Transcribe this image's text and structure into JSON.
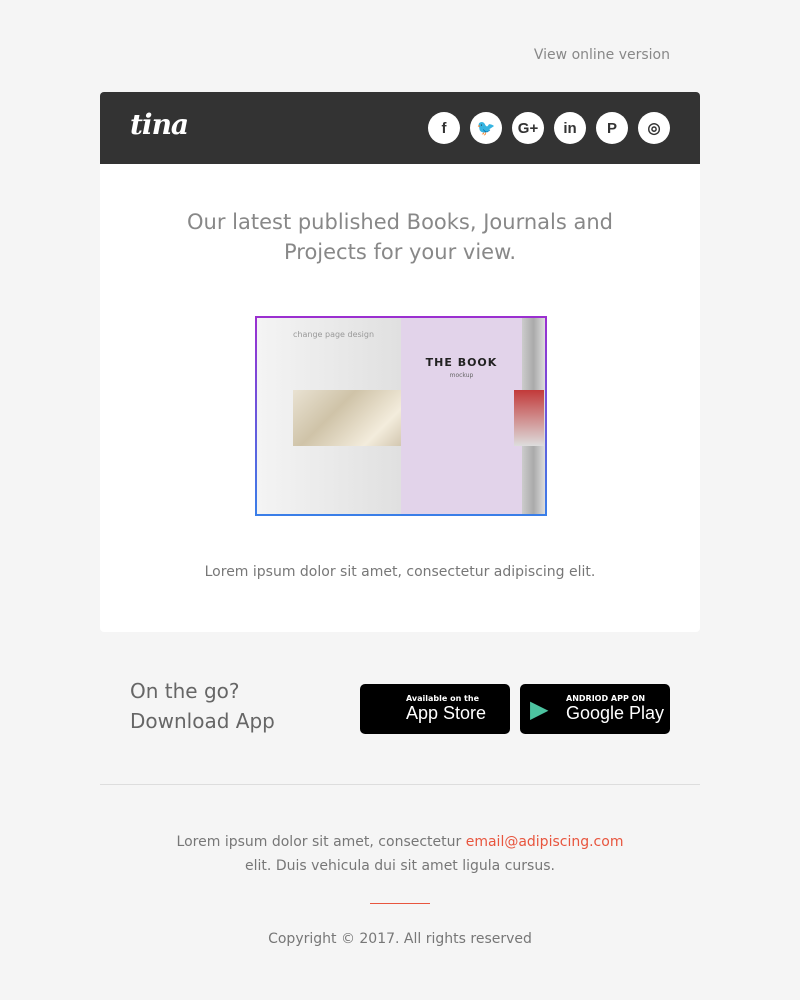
{
  "top": {
    "view_online": "View online version"
  },
  "header": {
    "logo": "tina",
    "socials": [
      {
        "name": "facebook",
        "glyph": "f"
      },
      {
        "name": "twitter",
        "glyph": "🐦"
      },
      {
        "name": "google-plus",
        "glyph": "G+"
      },
      {
        "name": "linkedin",
        "glyph": "in"
      },
      {
        "name": "pinterest",
        "glyph": "P"
      },
      {
        "name": "instagram",
        "glyph": "◎"
      }
    ]
  },
  "main": {
    "headline": "Our latest published Books, Journals and Projects for your view.",
    "book": {
      "left_title": "change page design",
      "right_title": "THE BOOK",
      "right_subtitle": "mockup"
    },
    "caption": "Lorem ipsum dolor sit amet, consectetur adipiscing elit."
  },
  "app": {
    "line1": "On the go?",
    "line2": "Download App",
    "appstore": {
      "small": "Available on the",
      "big": "App Store",
      "icon": ""
    },
    "googleplay": {
      "small": "ANDRIOD APP ON",
      "big": "Google Play",
      "icon": "▶"
    }
  },
  "footer": {
    "text_before": "Lorem ipsum dolor sit amet, consectetur ",
    "email": "email@adipiscing.com",
    "text_after": "elit. Duis vehicula dui sit amet ligula cursus.",
    "copyright": "Copyright © 2017. All rights reserved",
    "accent_color": "#e8553e"
  }
}
